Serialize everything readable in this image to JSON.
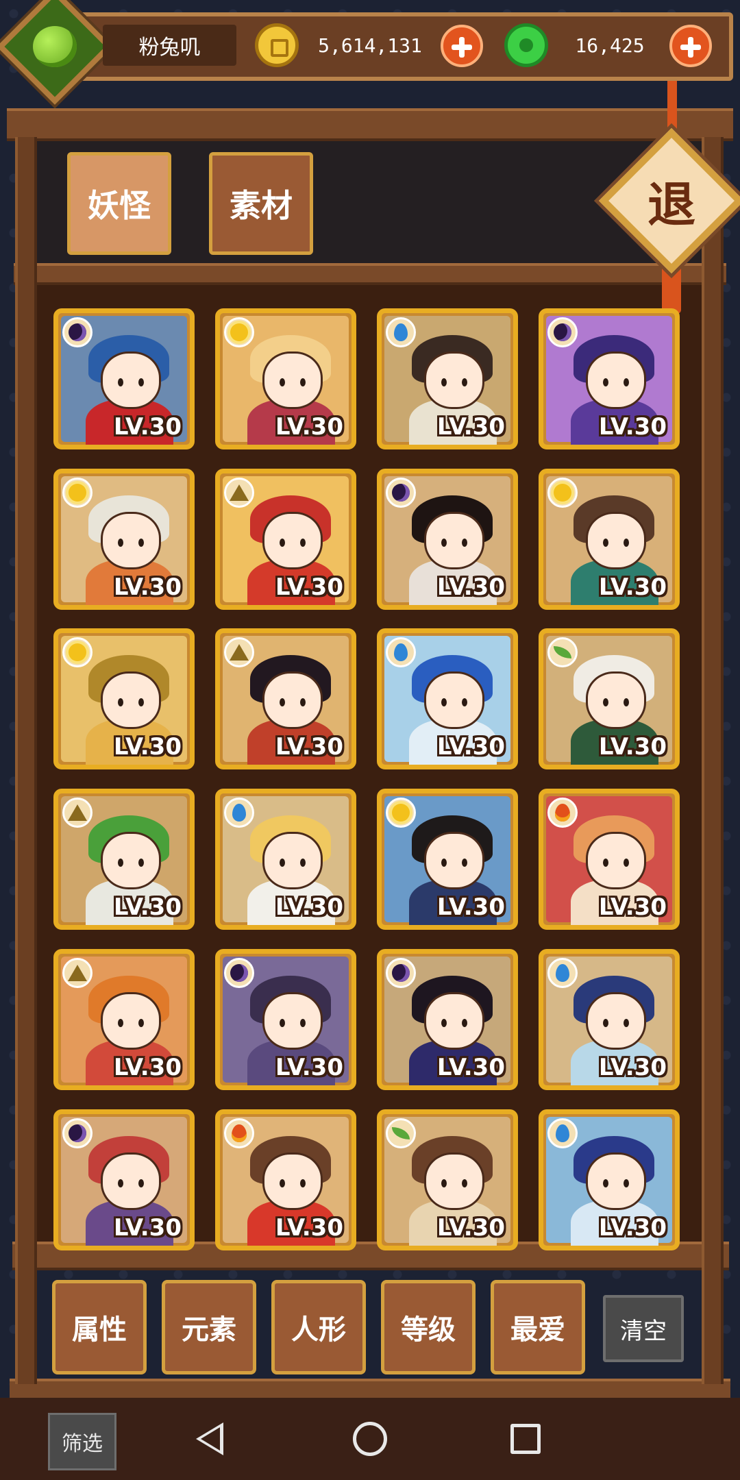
{
  "player": {
    "name": "粉兔叽",
    "gold": "5,614,131",
    "jade": "16,425"
  },
  "tabs": [
    {
      "label": "妖怪",
      "active": true
    },
    {
      "label": "素材",
      "active": false
    }
  ],
  "exit_label": "退",
  "cards": [
    {
      "element": "moon",
      "level": "LV.30",
      "hair": "#2b5ea8",
      "body": "#c8272a",
      "bg": "#6b8ab0"
    },
    {
      "element": "sun",
      "level": "LV.30",
      "hair": "#f3cf8a",
      "body": "#b53a4a",
      "bg": "#e9b76a"
    },
    {
      "element": "water",
      "level": "LV.30",
      "hair": "#3a2a22",
      "body": "#e9e2d0",
      "bg": "#c9a870"
    },
    {
      "element": "moon",
      "level": "LV.30",
      "hair": "#3b2a7a",
      "body": "#5a3a9a",
      "bg": "#b07ad0"
    },
    {
      "element": "sun",
      "level": "LV.30",
      "hair": "#e8e4d8",
      "body": "#e17a3a",
      "bg": "#e0bb82"
    },
    {
      "element": "earth",
      "level": "LV.30",
      "hair": "#c8322a",
      "body": "#d43a2a",
      "bg": "#f0c060"
    },
    {
      "element": "moon",
      "level": "LV.30",
      "hair": "#1e1412",
      "body": "#e8e0d8",
      "bg": "#d6b07c"
    },
    {
      "element": "sun",
      "level": "LV.30",
      "hair": "#5a3a28",
      "body": "#2e7e6e",
      "bg": "#d8b078"
    },
    {
      "element": "sun",
      "level": "LV.30",
      "hair": "#b0882a",
      "body": "#e6b24a",
      "bg": "#e8c06a"
    },
    {
      "element": "earth",
      "level": "LV.30",
      "hair": "#221820",
      "body": "#c0402a",
      "bg": "#e0b470"
    },
    {
      "element": "water",
      "level": "LV.30",
      "hair": "#2a5ec0",
      "body": "#e2eef6",
      "bg": "#a8d0e8"
    },
    {
      "element": "leaf",
      "level": "LV.30",
      "hair": "#f0ece4",
      "body": "#2e5a3a",
      "bg": "#d2b07a"
    },
    {
      "element": "earth",
      "level": "LV.30",
      "hair": "#4aa03a",
      "body": "#e8e8e0",
      "bg": "#cfa66a"
    },
    {
      "element": "water",
      "level": "LV.30",
      "hair": "#f0c860",
      "body": "#f2f0ea",
      "bg": "#d9bc88"
    },
    {
      "element": "sun",
      "level": "LV.30",
      "hair": "#1e1a1a",
      "body": "#2b3a6a",
      "bg": "#6a9ac8"
    },
    {
      "element": "fire",
      "level": "LV.30",
      "hair": "#e89a5a",
      "body": "#f4dfc6",
      "bg": "#d2504a"
    },
    {
      "element": "earth",
      "level": "LV.30",
      "hair": "#e07a2a",
      "body": "#d24a3a",
      "bg": "#e49a5a"
    },
    {
      "element": "moon",
      "level": "LV.30",
      "hair": "#3a2e4e",
      "body": "#5a4a7e",
      "bg": "#7a6a98"
    },
    {
      "element": "moon",
      "level": "LV.30",
      "hair": "#1e1620",
      "body": "#2e2a6a",
      "bg": "#c6a87a"
    },
    {
      "element": "water",
      "level": "LV.30",
      "hair": "#2a3a7a",
      "body": "#b8d8e8",
      "bg": "#d6b888"
    },
    {
      "element": "moon",
      "level": "LV.30",
      "hair": "#c2403a",
      "body": "#6a4a8a",
      "bg": "#d6a878"
    },
    {
      "element": "fire",
      "level": "LV.30",
      "hair": "#6a4028",
      "body": "#d8382a",
      "bg": "#e0b478"
    },
    {
      "element": "leaf",
      "level": "LV.30",
      "hair": "#6a4028",
      "body": "#e8d4b0",
      "bg": "#d6b07a"
    },
    {
      "element": "water",
      "level": "LV.30",
      "hair": "#2a3a8a",
      "body": "#d8e8f4",
      "bg": "#8ab8d8"
    }
  ],
  "filters": [
    "属性",
    "元素",
    "人形",
    "等级",
    "最爱"
  ],
  "clear_label": "清空",
  "filter_tag": "筛选",
  "colors": {
    "wood": "#7a4a29",
    "gold_frame": "#e8ad22",
    "accent_orange": "#e2541e"
  }
}
